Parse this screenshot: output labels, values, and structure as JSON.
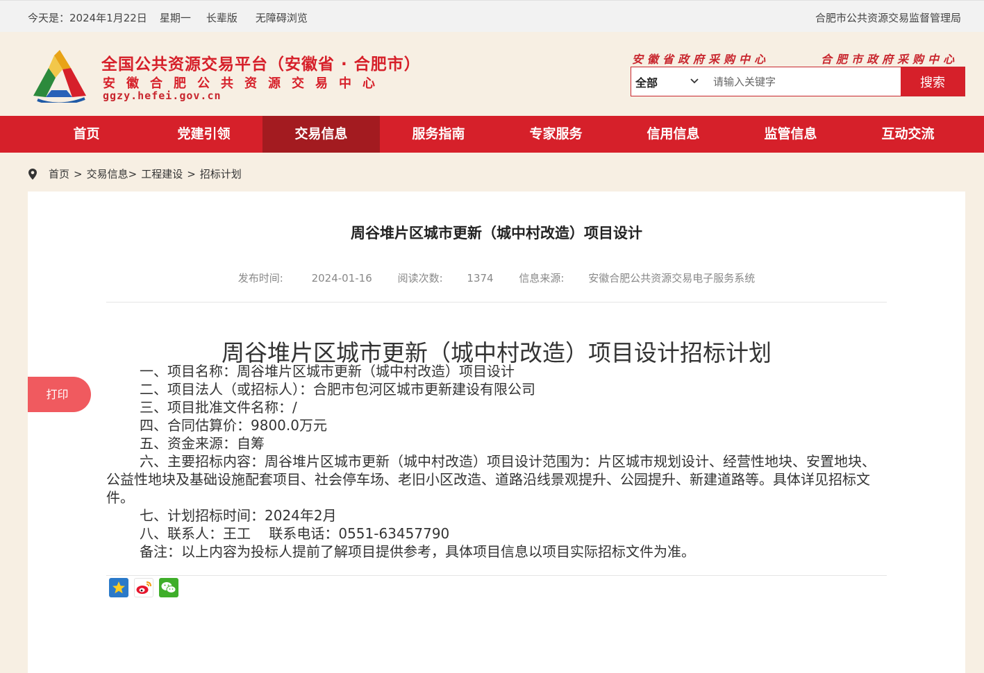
{
  "topbar": {
    "date_label": "今天是：2024年1月22日",
    "weekday": "星期一",
    "elder_mode": "长辈版",
    "accessibility": "无障碍浏览",
    "bureau_link": "合肥市公共资源交易监督管理局"
  },
  "header": {
    "title": "全国公共资源交易平台（安徽省 · 合肥市）",
    "subtitle": "安徽合肥公共资源交易中心",
    "url": "ggzy.hefei.gov.cn",
    "link_province": "安徽省政府采购中心",
    "link_city": "合肥市政府采购中心",
    "search": {
      "scope": "全部",
      "placeholder": "请输入关键字",
      "button": "搜索"
    }
  },
  "nav": {
    "items": [
      {
        "label": "首页"
      },
      {
        "label": "党建引领"
      },
      {
        "label": "交易信息"
      },
      {
        "label": "服务指南"
      },
      {
        "label": "专家服务"
      },
      {
        "label": "信用信息"
      },
      {
        "label": "监管信息"
      },
      {
        "label": "互动交流"
      }
    ],
    "active": "交易信息"
  },
  "breadcrumb": {
    "home": "首页",
    "sep": ">",
    "level1": "交易信息",
    "level2": "工程建设",
    "level3": "招标计划"
  },
  "article": {
    "title": "周谷堆片区城市更新（城中村改造）项目设计",
    "publish_label": "发布时间:",
    "publish_date": "2024-01-16",
    "views_label": "阅读次数:",
    "views": "1374",
    "source_label": "信息来源:",
    "source": "安徽合肥公共资源交易电子服务系统",
    "doc_title": "周谷堆片区城市更新（城中村改造）项目设计招标计划",
    "lines": [
      "一、项目名称：周谷堆片区城市更新（城中村改造）项目设计",
      "二、项目法人（或招标人）：合肥市包河区城市更新建设有限公司",
      "三、项目批准文件名称：/",
      "四、合同估算价：9800.0万元",
      "五、资金来源：自筹",
      "六、主要招标内容：周谷堆片区城市更新（城中村改造）项目设计范围为：片区城市规划设计、经营性地块、安置地块、公益性地块及基础设施配套项目、社会停车场、老旧小区改造、道路沿线景观提升、公园提升、新建道路等。具体详见招标文件。",
      "七、计划招标时间：2024年2月",
      "八、联系人：王工　 联系电话：0551-63457790",
      "备注：以上内容为投标人提前了解项目提供参考，具体项目信息以项目实际招标文件为准。"
    ],
    "print": "打印"
  },
  "colors": {
    "brand_red": "#d6202a",
    "nav_active": "#a31b20",
    "print_button": "#f05a5f",
    "page_bg": "#f7efe3"
  },
  "icons": {
    "breadcrumb": "location-pin-icon",
    "share": [
      "qzone-icon",
      "weibo-icon",
      "wechat-icon"
    ]
  }
}
